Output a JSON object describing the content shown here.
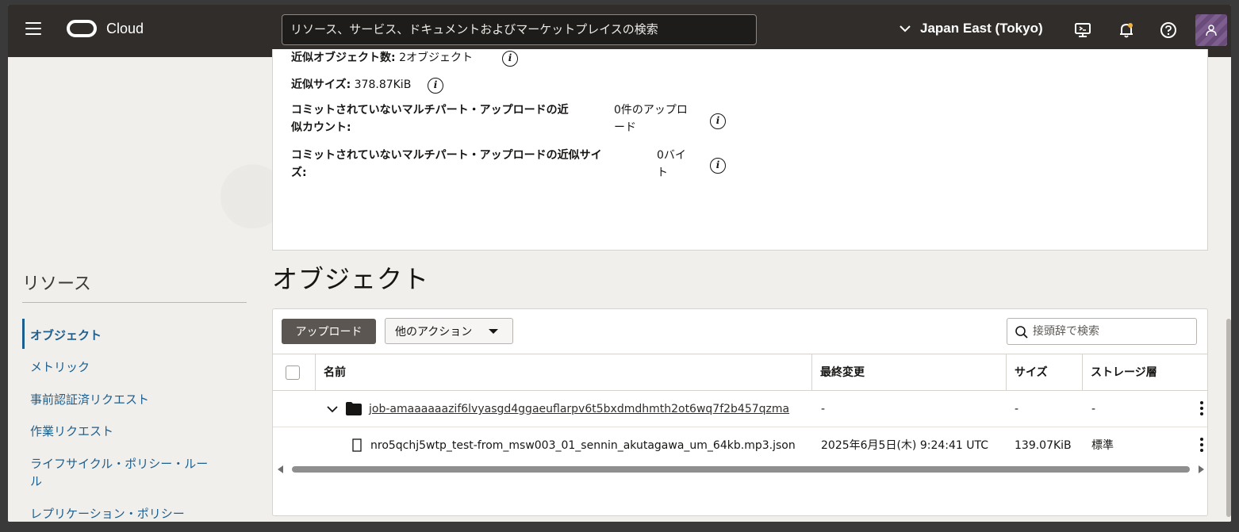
{
  "header": {
    "brand": "Cloud",
    "search_placeholder": "リソース、サービス、ドキュメントおよびマーケットプレイスの検索",
    "region": "Japan East (Tokyo)",
    "icons": [
      "menu-icon",
      "oracle-logo",
      "cloud-shell-icon",
      "bell-icon",
      "help-icon",
      "user-icon"
    ]
  },
  "info": {
    "approx_count_label": "近似オブジェクト数:",
    "approx_count_value": "2オブジェクト",
    "approx_size_label": "近似サイズ:",
    "approx_size_value": "378.87KiB",
    "uncommitted_count_label_1": "コミットされていないマルチパート・アップロードの近",
    "uncommitted_count_label_2": "似カウント:",
    "uncommitted_count_value_1": "0件のアップロ",
    "uncommitted_count_value_2": "ード",
    "uncommitted_size_label_1": "コミットされていないマルチパート・アップロードの近似サイ",
    "uncommitted_size_label_2": "ズ:",
    "uncommitted_size_value_1": "0バイ",
    "uncommitted_size_value_2": "ト",
    "info_glyph": "i"
  },
  "sidebar": {
    "title": "リソース",
    "items": [
      {
        "label": "オブジェクト",
        "active": true
      },
      {
        "label": "メトリック"
      },
      {
        "label": "事前認証済リクエスト"
      },
      {
        "label": "作業リクエスト"
      },
      {
        "label_1": "ライフサイクル・ポリシー・ルー",
        "label_2": "ル"
      },
      {
        "label": "レプリケーション・ポリシー"
      }
    ]
  },
  "objects": {
    "title": "オブジェクト",
    "upload_label": "アップロード",
    "more_actions_label": "他のアクション",
    "filter_placeholder": "接頭辞で検索",
    "columns": [
      "名前",
      "最終変更",
      "サイズ",
      "ストレージ層"
    ],
    "rows": [
      {
        "type": "folder",
        "name": "job-amaaaaaazif6lvyasgd4ggaeuflarpv6t5bxdmdhmth2ot6wq7f2b457qzma",
        "modified": "-",
        "size": "-",
        "tier": "-"
      },
      {
        "type": "file",
        "name": "nro5qchj5wtp_test-from_msw003_01_sennin_akutagawa_um_64kb.mp3.json",
        "modified": "2025年6月5日(木) 9:24:41 UTC",
        "size": "139.07KiB",
        "tier": "標準"
      }
    ]
  },
  "colors": {
    "header_bg": "#312d2a",
    "link": "#1c5f8f",
    "primary_button": "#5b5652"
  }
}
